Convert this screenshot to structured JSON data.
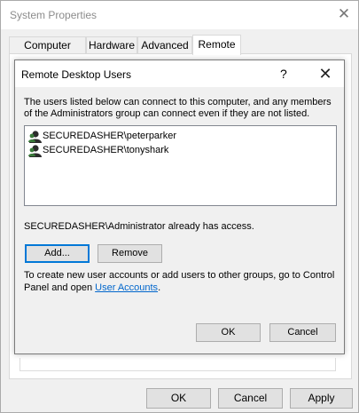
{
  "system_window": {
    "title": "System Properties",
    "tabs": [
      "Computer Name",
      "Hardware",
      "Advanced",
      "Remote"
    ],
    "active_tab": "Remote",
    "buttons": {
      "ok": "OK",
      "cancel": "Cancel",
      "apply": "Apply"
    }
  },
  "dialog": {
    "title": "Remote Desktop Users",
    "help_glyph": "?",
    "close_glyph": "✕",
    "description": "The users listed below can connect to this computer, and any members of the Administrators group can connect even if they are not listed.",
    "users": [
      "SECUREDASHER\\peterparker",
      "SECUREDASHER\\tonyshark"
    ],
    "access_text": "SECUREDASHER\\Administrator already has access.",
    "add_label": "Add...",
    "remove_label": "Remove",
    "note_prefix": "To create new user accounts or add users to other groups, go to Control Panel and open ",
    "note_link": "User Accounts",
    "note_suffix": ".",
    "ok_label": "OK",
    "cancel_label": "Cancel"
  },
  "icons": {
    "user": "user-icon"
  },
  "colors": {
    "link": "#0066cc",
    "focus": "#0078d7"
  }
}
